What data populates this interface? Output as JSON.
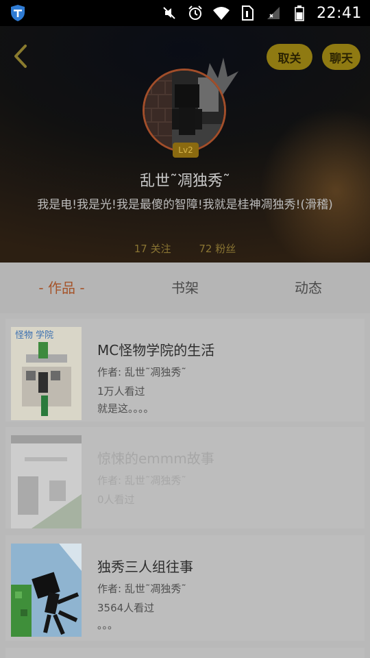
{
  "status_bar": {
    "time": "22:41",
    "icons": [
      "shield-app-icon",
      "mute-icon",
      "alarm-icon",
      "wifi-icon",
      "sim-icon",
      "signal-icon",
      "battery-icon"
    ]
  },
  "header": {
    "back_icon": "chevron-left-icon",
    "unfollow_label": "取关",
    "chat_label": "聊天",
    "level": "Lv2",
    "username": "乱世˜凋独秀˜",
    "bio": "我是电!我是光!我是最傻的智障!我就是桂神凋独秀!(滑稽)",
    "stats": {
      "following": "17 关注",
      "followers": "72 粉丝"
    }
  },
  "tabs": [
    {
      "label": "- 作品 -",
      "active": true
    },
    {
      "label": "书架",
      "active": false
    },
    {
      "label": "动态",
      "active": false
    }
  ],
  "works": [
    {
      "title": "MC怪物学院的生活",
      "author": "作者: 乱世˜凋独秀˜",
      "views": "1万人看过",
      "desc": "就是这。。。。"
    },
    {
      "title": "惊悚的emmm故事",
      "author": "作者: 乱世˜凋独秀˜",
      "views": "0人看过",
      "desc": ""
    },
    {
      "title": "独秀三人组往事",
      "author": "作者: 乱世˜凋独秀˜",
      "views": "3564人看过",
      "desc": "。。。"
    }
  ],
  "colors": {
    "accent_gold": "#8f7a12",
    "active_tab": "#a5542a",
    "background": "#b9b9b9"
  }
}
